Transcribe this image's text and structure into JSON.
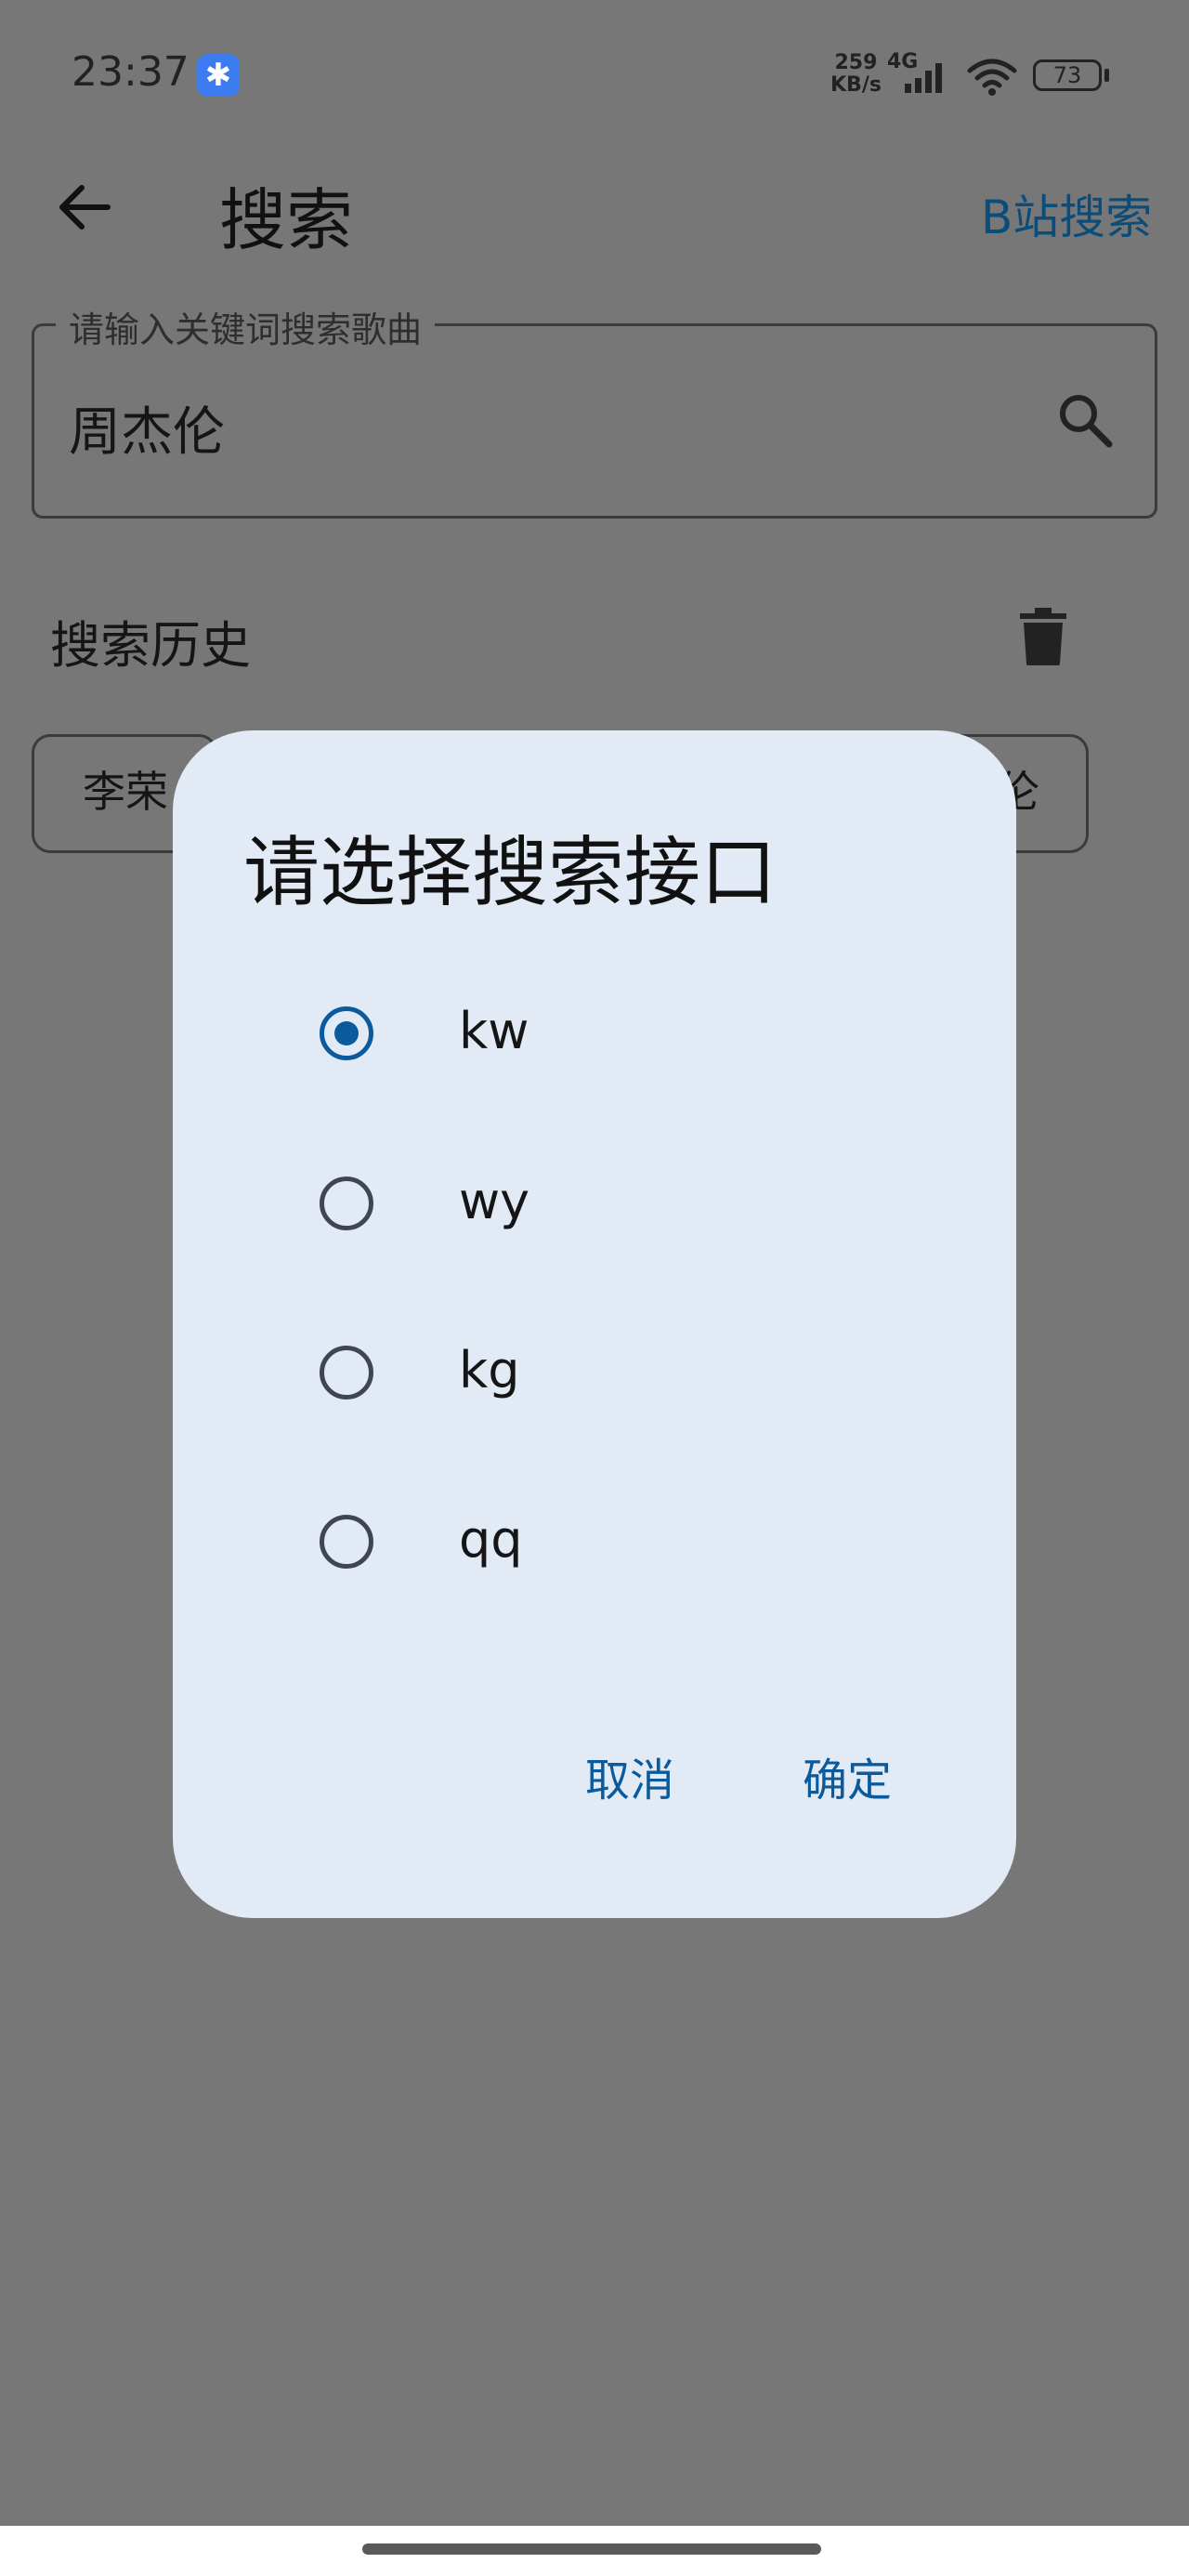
{
  "status_bar": {
    "time": "23:37",
    "notif_icon": "message-icon",
    "net_speed_value": "259",
    "net_speed_unit": "KB/s",
    "net_type": "4G",
    "battery": "73"
  },
  "app_bar": {
    "title": "搜索",
    "action_label": "B站搜索"
  },
  "search": {
    "label": "请输入关键词搜索歌曲",
    "value": "周杰伦"
  },
  "history": {
    "title": "搜索历史",
    "chips": [
      "李荣",
      "伦"
    ]
  },
  "dialog": {
    "title": "请选择搜索接口",
    "options": [
      {
        "label": "kw",
        "selected": true
      },
      {
        "label": "wy",
        "selected": false
      },
      {
        "label": "kg",
        "selected": false
      },
      {
        "label": "qq",
        "selected": false
      }
    ],
    "cancel_label": "取消",
    "confirm_label": "确定"
  },
  "colors": {
    "accent": "#0b5a9c",
    "dialog_bg": "#e2eaf6",
    "scrim": "#777777"
  }
}
